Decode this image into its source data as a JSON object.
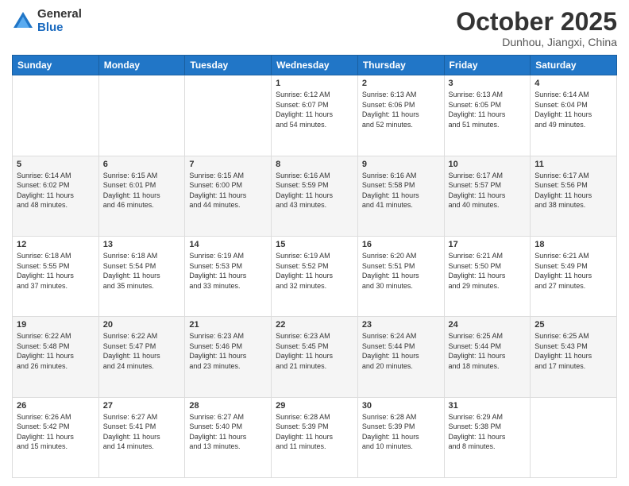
{
  "header": {
    "logo_general": "General",
    "logo_blue": "Blue",
    "month": "October 2025",
    "location": "Dunhou, Jiangxi, China"
  },
  "days_of_week": [
    "Sunday",
    "Monday",
    "Tuesday",
    "Wednesday",
    "Thursday",
    "Friday",
    "Saturday"
  ],
  "weeks": [
    [
      {
        "day": "",
        "content": ""
      },
      {
        "day": "",
        "content": ""
      },
      {
        "day": "",
        "content": ""
      },
      {
        "day": "1",
        "content": "Sunrise: 6:12 AM\nSunset: 6:07 PM\nDaylight: 11 hours\nand 54 minutes."
      },
      {
        "day": "2",
        "content": "Sunrise: 6:13 AM\nSunset: 6:06 PM\nDaylight: 11 hours\nand 52 minutes."
      },
      {
        "day": "3",
        "content": "Sunrise: 6:13 AM\nSunset: 6:05 PM\nDaylight: 11 hours\nand 51 minutes."
      },
      {
        "day": "4",
        "content": "Sunrise: 6:14 AM\nSunset: 6:04 PM\nDaylight: 11 hours\nand 49 minutes."
      }
    ],
    [
      {
        "day": "5",
        "content": "Sunrise: 6:14 AM\nSunset: 6:02 PM\nDaylight: 11 hours\nand 48 minutes."
      },
      {
        "day": "6",
        "content": "Sunrise: 6:15 AM\nSunset: 6:01 PM\nDaylight: 11 hours\nand 46 minutes."
      },
      {
        "day": "7",
        "content": "Sunrise: 6:15 AM\nSunset: 6:00 PM\nDaylight: 11 hours\nand 44 minutes."
      },
      {
        "day": "8",
        "content": "Sunrise: 6:16 AM\nSunset: 5:59 PM\nDaylight: 11 hours\nand 43 minutes."
      },
      {
        "day": "9",
        "content": "Sunrise: 6:16 AM\nSunset: 5:58 PM\nDaylight: 11 hours\nand 41 minutes."
      },
      {
        "day": "10",
        "content": "Sunrise: 6:17 AM\nSunset: 5:57 PM\nDaylight: 11 hours\nand 40 minutes."
      },
      {
        "day": "11",
        "content": "Sunrise: 6:17 AM\nSunset: 5:56 PM\nDaylight: 11 hours\nand 38 minutes."
      }
    ],
    [
      {
        "day": "12",
        "content": "Sunrise: 6:18 AM\nSunset: 5:55 PM\nDaylight: 11 hours\nand 37 minutes."
      },
      {
        "day": "13",
        "content": "Sunrise: 6:18 AM\nSunset: 5:54 PM\nDaylight: 11 hours\nand 35 minutes."
      },
      {
        "day": "14",
        "content": "Sunrise: 6:19 AM\nSunset: 5:53 PM\nDaylight: 11 hours\nand 33 minutes."
      },
      {
        "day": "15",
        "content": "Sunrise: 6:19 AM\nSunset: 5:52 PM\nDaylight: 11 hours\nand 32 minutes."
      },
      {
        "day": "16",
        "content": "Sunrise: 6:20 AM\nSunset: 5:51 PM\nDaylight: 11 hours\nand 30 minutes."
      },
      {
        "day": "17",
        "content": "Sunrise: 6:21 AM\nSunset: 5:50 PM\nDaylight: 11 hours\nand 29 minutes."
      },
      {
        "day": "18",
        "content": "Sunrise: 6:21 AM\nSunset: 5:49 PM\nDaylight: 11 hours\nand 27 minutes."
      }
    ],
    [
      {
        "day": "19",
        "content": "Sunrise: 6:22 AM\nSunset: 5:48 PM\nDaylight: 11 hours\nand 26 minutes."
      },
      {
        "day": "20",
        "content": "Sunrise: 6:22 AM\nSunset: 5:47 PM\nDaylight: 11 hours\nand 24 minutes."
      },
      {
        "day": "21",
        "content": "Sunrise: 6:23 AM\nSunset: 5:46 PM\nDaylight: 11 hours\nand 23 minutes."
      },
      {
        "day": "22",
        "content": "Sunrise: 6:23 AM\nSunset: 5:45 PM\nDaylight: 11 hours\nand 21 minutes."
      },
      {
        "day": "23",
        "content": "Sunrise: 6:24 AM\nSunset: 5:44 PM\nDaylight: 11 hours\nand 20 minutes."
      },
      {
        "day": "24",
        "content": "Sunrise: 6:25 AM\nSunset: 5:44 PM\nDaylight: 11 hours\nand 18 minutes."
      },
      {
        "day": "25",
        "content": "Sunrise: 6:25 AM\nSunset: 5:43 PM\nDaylight: 11 hours\nand 17 minutes."
      }
    ],
    [
      {
        "day": "26",
        "content": "Sunrise: 6:26 AM\nSunset: 5:42 PM\nDaylight: 11 hours\nand 15 minutes."
      },
      {
        "day": "27",
        "content": "Sunrise: 6:27 AM\nSunset: 5:41 PM\nDaylight: 11 hours\nand 14 minutes."
      },
      {
        "day": "28",
        "content": "Sunrise: 6:27 AM\nSunset: 5:40 PM\nDaylight: 11 hours\nand 13 minutes."
      },
      {
        "day": "29",
        "content": "Sunrise: 6:28 AM\nSunset: 5:39 PM\nDaylight: 11 hours\nand 11 minutes."
      },
      {
        "day": "30",
        "content": "Sunrise: 6:28 AM\nSunset: 5:39 PM\nDaylight: 11 hours\nand 10 minutes."
      },
      {
        "day": "31",
        "content": "Sunrise: 6:29 AM\nSunset: 5:38 PM\nDaylight: 11 hours\nand 8 minutes."
      },
      {
        "day": "",
        "content": ""
      }
    ]
  ]
}
